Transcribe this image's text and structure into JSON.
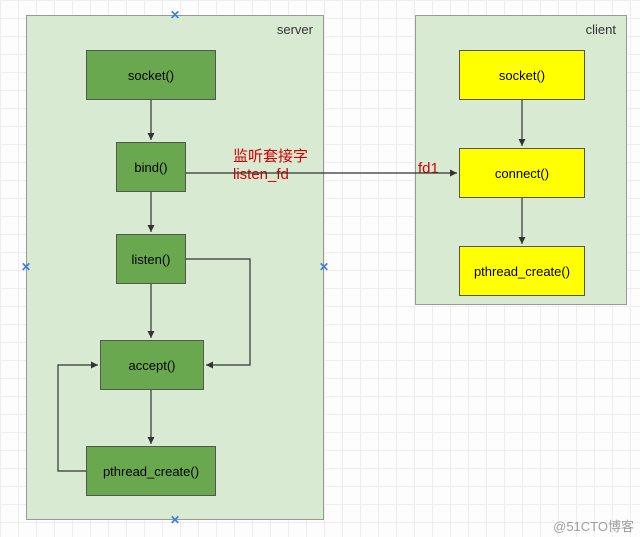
{
  "server": {
    "title": "server",
    "nodes": {
      "socket": "socket()",
      "bind": "bind()",
      "listen": "listen()",
      "accept": "accept()",
      "pthread": "pthread_create()"
    }
  },
  "client": {
    "title": "client",
    "nodes": {
      "socket": "socket()",
      "connect": "connect()",
      "pthread": "pthread_create()"
    }
  },
  "annotations": {
    "listen_note_line1": "监听套接字",
    "listen_note_line2": "listen_fd",
    "fd1": "fd1"
  },
  "watermark": "@51CTO博客"
}
